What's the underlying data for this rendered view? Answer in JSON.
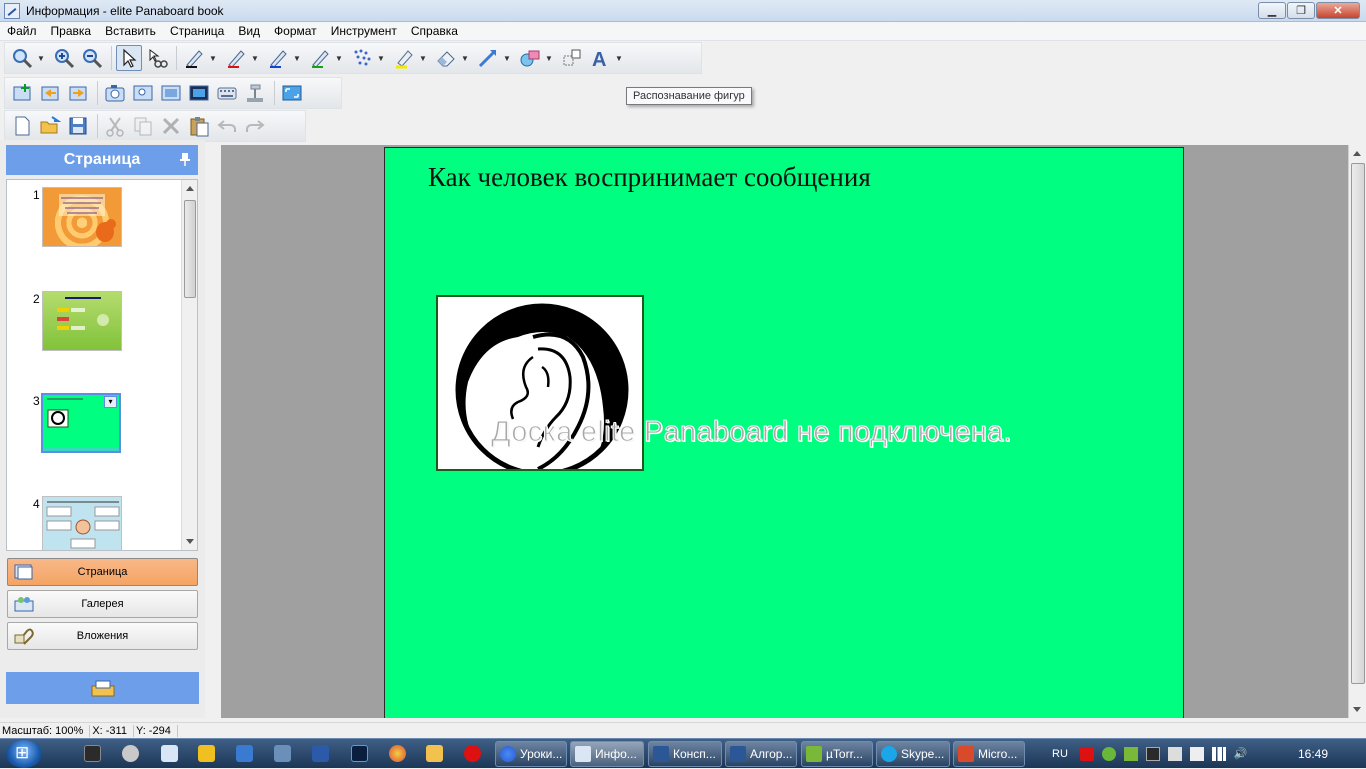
{
  "window": {
    "title": "Информация - elite Panaboard book"
  },
  "menu": [
    "Файл",
    "Правка",
    "Вставить",
    "Страница",
    "Вид",
    "Формат",
    "Инструмент",
    "Справка"
  ],
  "tooltip": "Распознавание фигур",
  "side_panel": {
    "header": "Страница",
    "thumbnails": [
      {
        "number": "1"
      },
      {
        "number": "2"
      },
      {
        "number": "3"
      },
      {
        "number": "4"
      }
    ],
    "tabs": [
      "Страница",
      "Галерея",
      "Вложения"
    ]
  },
  "page": {
    "title": "Как человек воспринимает сообщения",
    "overlay_message": "Доска elite Panaboard не подключена.",
    "background": "#00ff80"
  },
  "status": {
    "zoom": "Масштаб: 100%",
    "x": "X: -311",
    "y": "Y: -294"
  },
  "taskbar": {
    "tasks": [
      "Уроки...",
      "Инфо...",
      "Консп...",
      "Алгор...",
      "µTorr...",
      "Skype...",
      "Micro..."
    ],
    "lang": "RU",
    "clock": "16:49"
  },
  "colors": {
    "accent": "#6d9eea",
    "active_tab": "#f4a464",
    "page_bg": "#00ff80",
    "canvas_bg": "#a0a0a0"
  }
}
